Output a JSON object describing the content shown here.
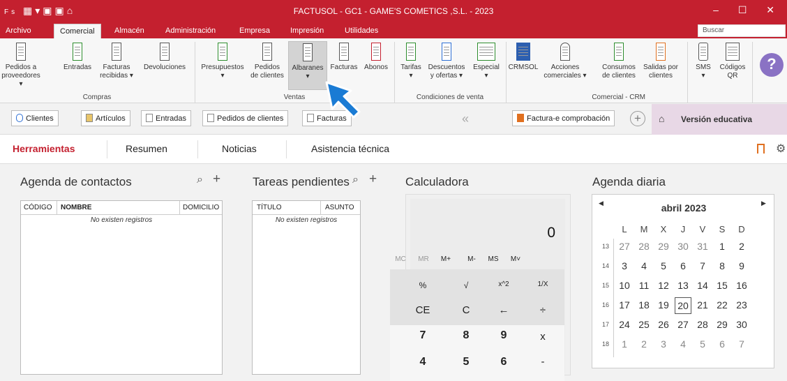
{
  "titlebar": {
    "title": "FACTUSOL - GC1 - GAME'S COMETICS ,S.L. - 2023",
    "logo": "Fs",
    "winctl": "– ☐ ✕"
  },
  "menu": [
    "Archivo",
    "Comercial",
    "Almacén",
    "Administración",
    "Empresa",
    "Impresión",
    "Utilidades"
  ],
  "search": {
    "placeholder": "Buscar"
  },
  "ribbon": {
    "buttons": [
      {
        "l1": "Pedidos a",
        "l2": "proveedores ▾"
      },
      {
        "l1": "Entradas",
        "l2": ""
      },
      {
        "l1": "Facturas",
        "l2": "recibidas ▾"
      },
      {
        "l1": "Devoluciones",
        "l2": ""
      },
      {
        "l1": "Presupuestos",
        "l2": "▾"
      },
      {
        "l1": "Pedidos",
        "l2": "de clientes"
      },
      {
        "l1": "Albaranes",
        "l2": "▾"
      },
      {
        "l1": "Facturas",
        "l2": ""
      },
      {
        "l1": "Abonos",
        "l2": ""
      },
      {
        "l1": "Tarifas",
        "l2": "▾"
      },
      {
        "l1": "Descuentos",
        "l2": "y ofertas ▾"
      },
      {
        "l1": "Especial",
        "l2": "▾"
      },
      {
        "l1": "CRMSOL",
        "l2": ""
      },
      {
        "l1": "Acciones",
        "l2": "comerciales ▾"
      },
      {
        "l1": "Consumos",
        "l2": "de clientes"
      },
      {
        "l1": "Salidas por",
        "l2": "clientes"
      },
      {
        "l1": "SMS",
        "l2": "▾"
      },
      {
        "l1": "Códigos",
        "l2": "QR"
      }
    ],
    "groups": [
      "Compras",
      "Ventas",
      "Condiciones de venta",
      "Comercial - CRM"
    ]
  },
  "toolbar": {
    "clientes": "Clientes",
    "articulos": "Artículos",
    "entradas": "Entradas",
    "pedidos": "Pedidos de clientes",
    "facturas": "Facturas",
    "collapse": "«",
    "facturae": "Factura-e comprobación",
    "add": "+",
    "edu": "Versión educativa"
  },
  "tabs": [
    "Herramientas",
    "Resumen",
    "Noticias",
    "Asistencia técnica"
  ],
  "contacts": {
    "title": "Agenda de contactos",
    "cols": [
      "CÓDIGO",
      "NOMBRE",
      "DOMICILIO"
    ],
    "empty": "No existen registros"
  },
  "tasks": {
    "title": "Tareas pendientes",
    "cols": [
      "TÍTULO",
      "ASUNTO"
    ],
    "empty": "No existen registros"
  },
  "calculator": {
    "title": "Calculadora",
    "display": "0",
    "mem": [
      "MC",
      "MR",
      "M+",
      "M-",
      "MS",
      "M˅"
    ],
    "rows": [
      [
        "%",
        "√",
        "x^2",
        "1/X"
      ],
      [
        "CE",
        "C",
        "←",
        "÷"
      ],
      [
        "7",
        "8",
        "9",
        "x"
      ],
      [
        "4",
        "5",
        "6",
        "-"
      ]
    ]
  },
  "agenda": {
    "title": "Agenda diaria",
    "month": "abril 2023",
    "dow": [
      "L",
      "M",
      "X",
      "J",
      "V",
      "S",
      "D"
    ],
    "weeks": [
      {
        "n": "13",
        "d": [
          "27",
          "28",
          "29",
          "30",
          "31",
          "1",
          "2"
        ]
      },
      {
        "n": "14",
        "d": [
          "3",
          "4",
          "5",
          "6",
          "7",
          "8",
          "9"
        ]
      },
      {
        "n": "15",
        "d": [
          "10",
          "11",
          "12",
          "13",
          "14",
          "15",
          "16"
        ]
      },
      {
        "n": "16",
        "d": [
          "17",
          "18",
          "19",
          "20",
          "21",
          "22",
          "23"
        ]
      },
      {
        "n": "17",
        "d": [
          "24",
          "25",
          "26",
          "27",
          "28",
          "29",
          "30"
        ]
      },
      {
        "n": "18",
        "d": [
          "1",
          "2",
          "3",
          "4",
          "5",
          "6",
          "7"
        ]
      }
    ],
    "today": "20"
  },
  "colors": {
    "brand": "#c4202f",
    "cursor": "#1a7bd4"
  }
}
